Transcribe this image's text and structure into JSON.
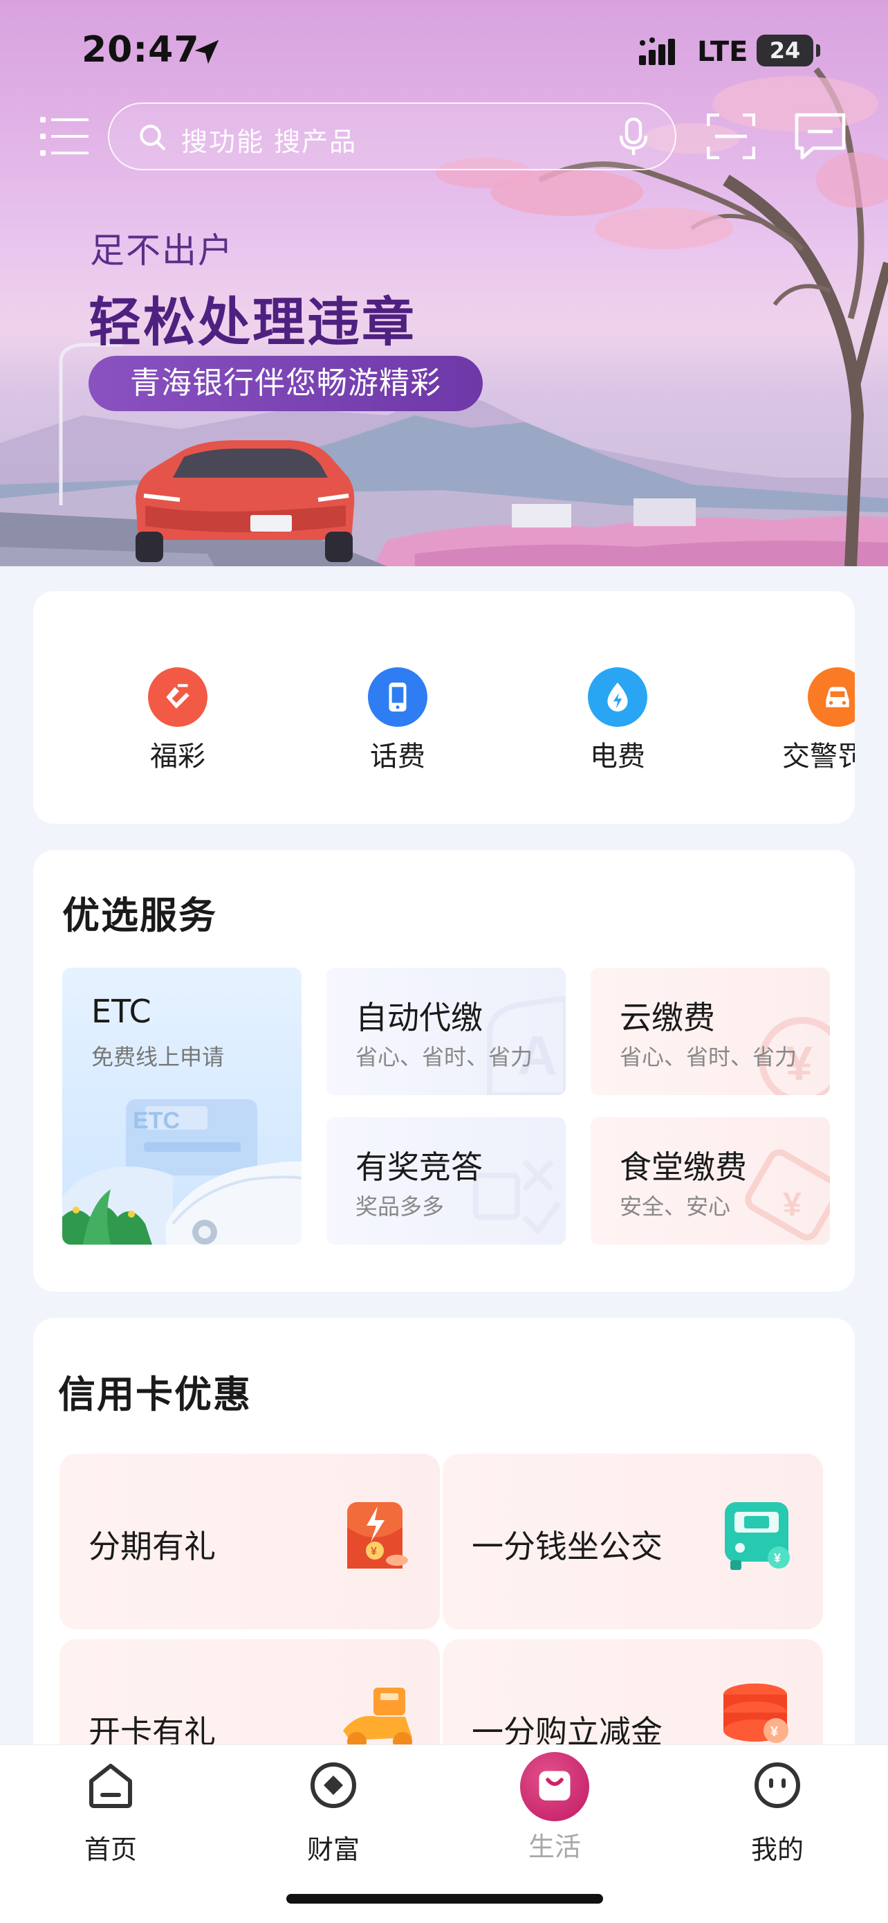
{
  "status_bar": {
    "time": "20:47",
    "network": "LTE",
    "battery": "24"
  },
  "header": {
    "search_placeholder": "搜功能 搜产品"
  },
  "banner": {
    "subtitle": "足不出户",
    "title": "轻松处理违章",
    "pill": "青海银行伴您畅游精彩"
  },
  "quick_actions": [
    {
      "label": "福彩",
      "icon": "lottery-icon",
      "color": "#f25a45"
    },
    {
      "label": "话费",
      "icon": "phone-bill-icon",
      "color": "#2f7df3"
    },
    {
      "label": "电费",
      "icon": "electricity-icon",
      "color": "#29a5f4"
    },
    {
      "label": "交警罚没",
      "icon": "traffic-police-car-icon",
      "color": "#fb7a24"
    }
  ],
  "services": {
    "title": "优选服务",
    "etc": {
      "title": "ETC",
      "subtitle": "免费线上申请"
    },
    "tiles": [
      {
        "title": "自动代缴",
        "subtitle": "省心、省时、省力"
      },
      {
        "title": "云缴费",
        "subtitle": "省心、省时、省力"
      },
      {
        "title": "有奖竞答",
        "subtitle": "奖品多多"
      },
      {
        "title": "食堂缴费",
        "subtitle": "安全、安心"
      }
    ]
  },
  "credit": {
    "title": "信用卡优惠",
    "items": [
      {
        "title": "分期有礼"
      },
      {
        "title": "一分钱坐公交"
      },
      {
        "title": "开卡有礼"
      },
      {
        "title": "一分购立减金"
      }
    ]
  },
  "tabbar": [
    {
      "label": "首页"
    },
    {
      "label": "财富"
    },
    {
      "label": "生活",
      "active": true
    },
    {
      "label": "我的"
    }
  ]
}
